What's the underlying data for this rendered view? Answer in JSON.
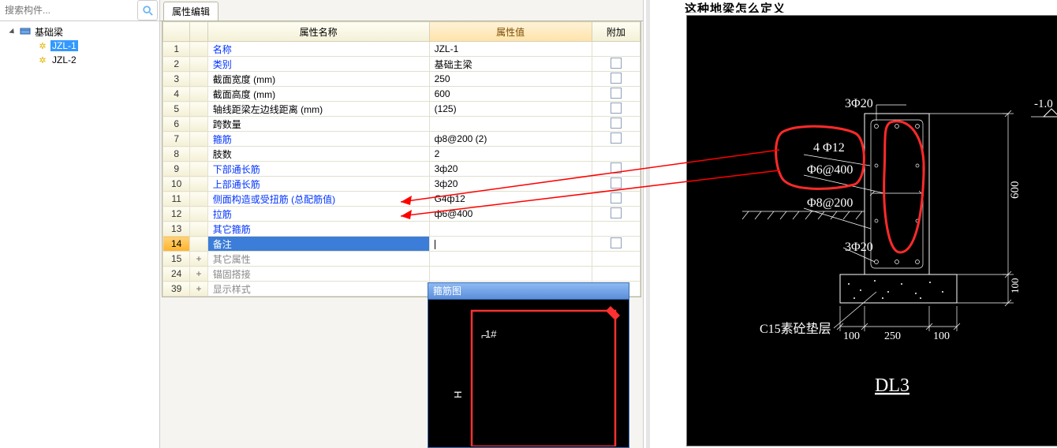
{
  "search": {
    "placeholder": "搜索构件..."
  },
  "tree": {
    "root_label": "基础梁",
    "items": [
      {
        "label": "JZL-1",
        "selected": true
      },
      {
        "label": "JZL-2",
        "selected": false
      }
    ]
  },
  "tab_label": "属性编辑",
  "grid": {
    "headers": {
      "name": "属性名称",
      "value": "属性值",
      "add": "附加"
    },
    "rows": [
      {
        "n": "1",
        "name": "名称",
        "blue": true,
        "value": "JZL-1",
        "add": false
      },
      {
        "n": "2",
        "name": "类别",
        "blue": true,
        "value": "基础主梁",
        "add": true
      },
      {
        "n": "3",
        "name": "截面宽度 (mm)",
        "blue": false,
        "value": "250",
        "add": true
      },
      {
        "n": "4",
        "name": "截面高度 (mm)",
        "blue": false,
        "value": "600",
        "add": true
      },
      {
        "n": "5",
        "name": "轴线距梁左边线距离 (mm)",
        "blue": false,
        "value": "(125)",
        "add": true
      },
      {
        "n": "6",
        "name": "跨数量",
        "blue": false,
        "value": "",
        "add": true
      },
      {
        "n": "7",
        "name": "箍筋",
        "blue": true,
        "value": "ф8@200 (2)",
        "add": true
      },
      {
        "n": "8",
        "name": "肢数",
        "blue": false,
        "value": "2",
        "add": false
      },
      {
        "n": "9",
        "name": "下部通长筋",
        "blue": true,
        "value": "3ф20",
        "add": true
      },
      {
        "n": "10",
        "name": "上部通长筋",
        "blue": true,
        "value": "3ф20",
        "add": true
      },
      {
        "n": "11",
        "name": "侧面构造或受扭筋 (总配筋值)",
        "blue": true,
        "value": "G4ф12",
        "add": true
      },
      {
        "n": "12",
        "name": "拉筋",
        "blue": true,
        "value": "ф6@400",
        "add": true
      },
      {
        "n": "13",
        "name": "其它箍筋",
        "blue": true,
        "value": "",
        "add": false
      },
      {
        "n": "14",
        "name": "备注",
        "blue": true,
        "value": "",
        "add": true,
        "selected": true
      },
      {
        "n": "15",
        "name": "其它属性",
        "gray": true,
        "exp": "+",
        "value": "",
        "add": false
      },
      {
        "n": "24",
        "name": "锚固搭接",
        "gray": true,
        "exp": "+",
        "value": "",
        "add": false
      },
      {
        "n": "39",
        "name": "显示样式",
        "gray": true,
        "exp": "+",
        "value": "",
        "add": false
      }
    ]
  },
  "popup": {
    "title": "箍筋图",
    "label_hash": "1#"
  },
  "right": {
    "title_fragment": "这种地梁怎么定义",
    "cad": {
      "t_top": "3Φ20",
      "t_4d12": "4 Φ12",
      "t_d6_400": "Φ6@400",
      "t_d8_200": "Φ8@200",
      "t_bot": "3Φ20",
      "t_c15": "C15素砼垫层",
      "t_dl3": "DL3",
      "dim_600": "600",
      "dim_100a": "100",
      "dim_250": "250",
      "dim_100b": "100",
      "dim_side100": "100",
      "elev": "-1.0"
    }
  }
}
